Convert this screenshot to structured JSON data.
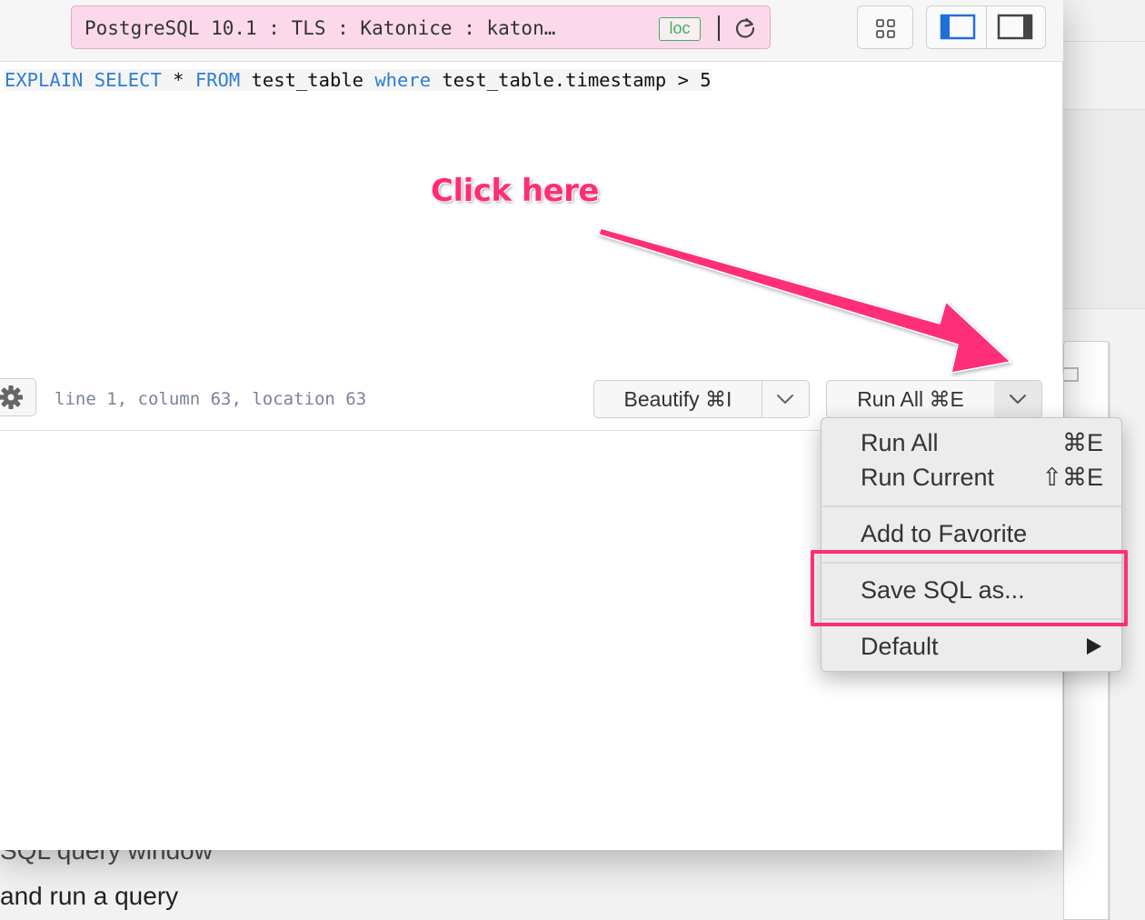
{
  "connection": {
    "label": "PostgreSQL 10.1 : TLS : Katonice : katon…",
    "badge": "loc"
  },
  "editor": {
    "tokens": [
      {
        "text": "EXPLAIN",
        "kind": "keyword"
      },
      {
        "text": " ",
        "kind": "plain"
      },
      {
        "text": "SELECT",
        "kind": "keyword"
      },
      {
        "text": " * ",
        "kind": "plain"
      },
      {
        "text": "FROM",
        "kind": "keyword"
      },
      {
        "text": " test_table ",
        "kind": "plain"
      },
      {
        "text": "where",
        "kind": "keyword"
      },
      {
        "text": " test_table.timestamp > 5",
        "kind": "plain"
      }
    ]
  },
  "annotation": {
    "text": "Click here",
    "color": "#ff2d78"
  },
  "status_bar": {
    "cursor": "line 1, column 63, location 63"
  },
  "buttons": {
    "beautify": "Beautify ⌘I",
    "run_all": "Run All ⌘E"
  },
  "menu": {
    "run_all": {
      "label": "Run All",
      "shortcut": "⌘E"
    },
    "run_current": {
      "label": "Run Current",
      "shortcut": "⇧⌘E"
    },
    "add_favorite": {
      "label": "Add to Favorite"
    },
    "save_sql": {
      "label": "Save SQL as..."
    },
    "default": {
      "label": "Default"
    }
  },
  "background": {
    "line1": "SQL query window",
    "line2": "and run a query"
  },
  "colors": {
    "keyword": "#2f7fd1",
    "accent_pink": "#ff2d78",
    "connection_bg": "#fbd9ea",
    "loc_badge": "#3fb15b"
  }
}
